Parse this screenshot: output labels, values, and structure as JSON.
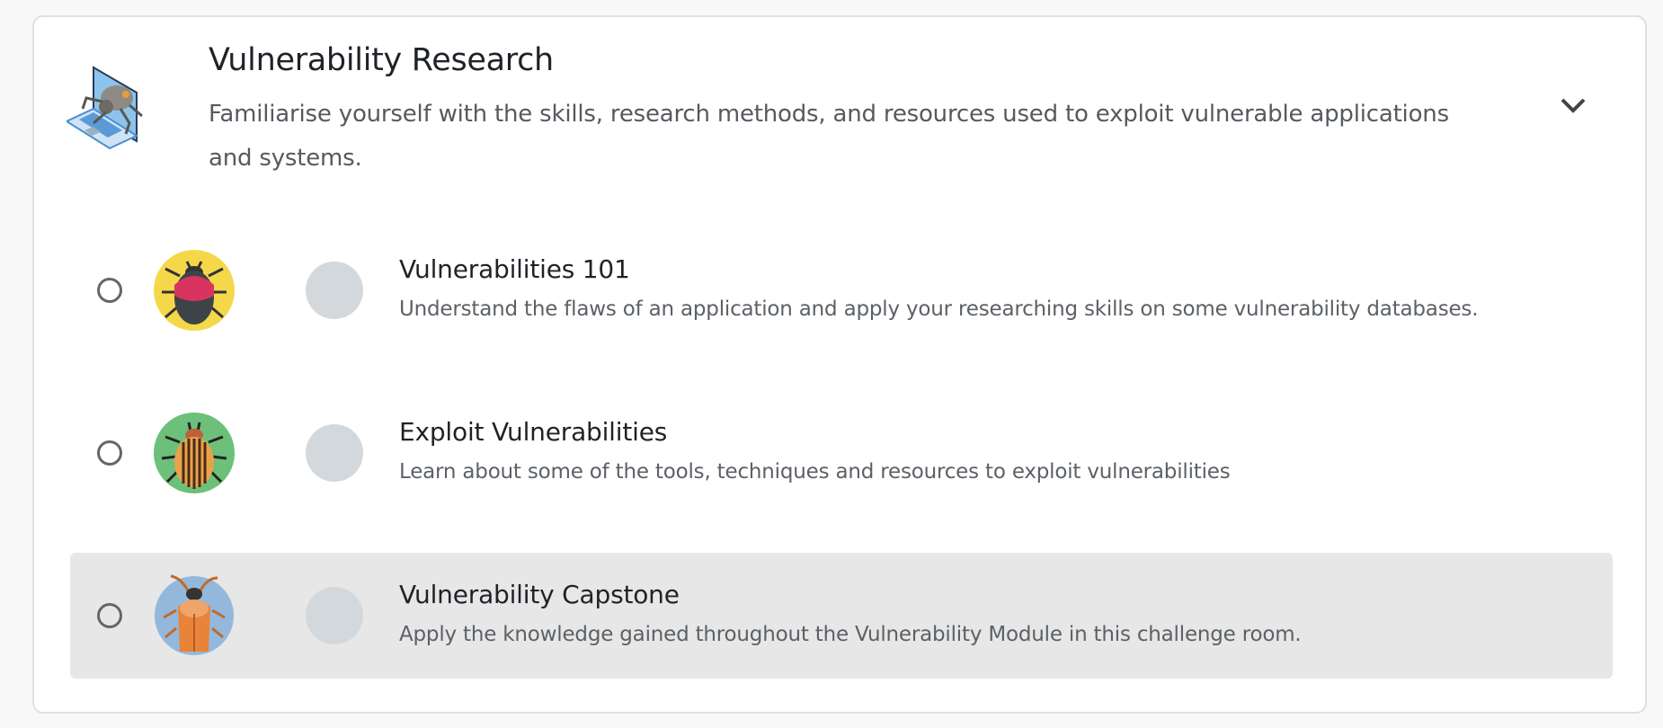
{
  "module": {
    "title": "Vulnerability Research",
    "description": "Familiarise yourself with the skills, research methods, and resources used to exploit vulnerable applications and systems.",
    "icon": "laptop-spider-robot-icon",
    "expand_icon": "chevron-down-icon"
  },
  "rooms": [
    {
      "title": "Vulnerabilities 101",
      "description": "Understand the flaws of an application and apply your researching skills on some vulnerability databases.",
      "icon": "red-bug-yellow-circle-icon",
      "highlighted": false
    },
    {
      "title": "Exploit Vulnerabilities",
      "description": "Learn about some of the tools, techniques and resources to exploit vulnerabilities",
      "icon": "striped-beetle-green-circle-icon",
      "highlighted": false
    },
    {
      "title": "Vulnerability Capstone",
      "description": "Apply the knowledge gained throughout the Vulnerability Module in this challenge room.",
      "icon": "orange-cockroach-blue-circle-icon",
      "highlighted": true
    }
  ],
  "colors": {
    "highlight_bg": "#e7e7e7",
    "status_circle": "#d3d8dc"
  }
}
